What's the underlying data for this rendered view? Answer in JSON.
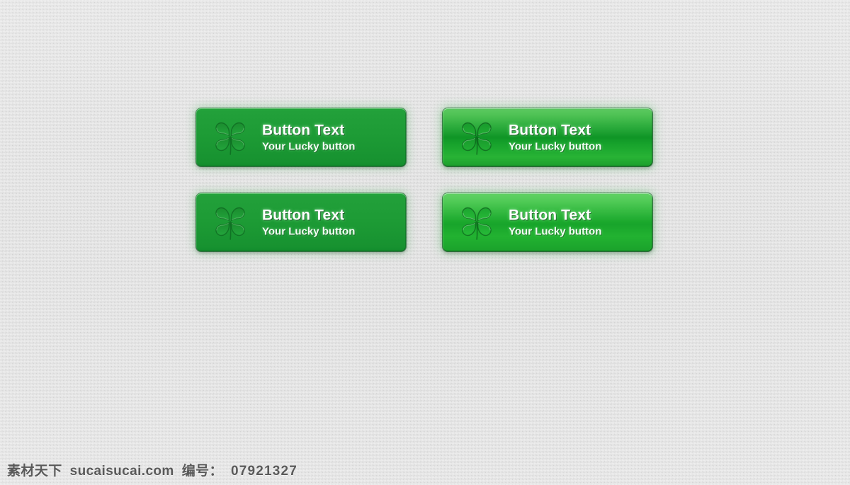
{
  "page": {
    "background_color": "#dedede",
    "texture": "noise-grain"
  },
  "buttons": [
    {
      "id": "button-flat-1",
      "style": "flat",
      "icon": "four-leaf-clover-icon",
      "title": "Button Text",
      "subtitle": "Your Lucky button",
      "base_color": "#1d9b35",
      "title_color": "#ffffff",
      "subtitle_color": "#f2fff4"
    },
    {
      "id": "button-gloss-1",
      "style": "glossy",
      "icon": "four-leaf-clover-icon",
      "title": "Button Text",
      "subtitle": "Your Lucky button",
      "base_color": "#17a02b",
      "title_color": "#ffffff",
      "subtitle_color": "#f2fff4"
    },
    {
      "id": "button-flat-2",
      "style": "flat",
      "icon": "four-leaf-clover-icon",
      "title": "Button Text",
      "subtitle": "Your Lucky button",
      "base_color": "#1d9b35",
      "title_color": "#ffffff",
      "subtitle_color": "#f2fff4"
    },
    {
      "id": "button-gloss-2",
      "style": "glossy-bright",
      "icon": "four-leaf-clover-icon",
      "title": "Button Text",
      "subtitle": "Your Lucky button",
      "base_color": "#1fae2f",
      "title_color": "#ffffff",
      "subtitle_color": "#f2fff4"
    }
  ],
  "watermark": {
    "site_name": "素材天下",
    "domain": "sucaisucai.com",
    "code_label": "编号：",
    "code_value": "07921327",
    "color": "#5a5a5a"
  }
}
